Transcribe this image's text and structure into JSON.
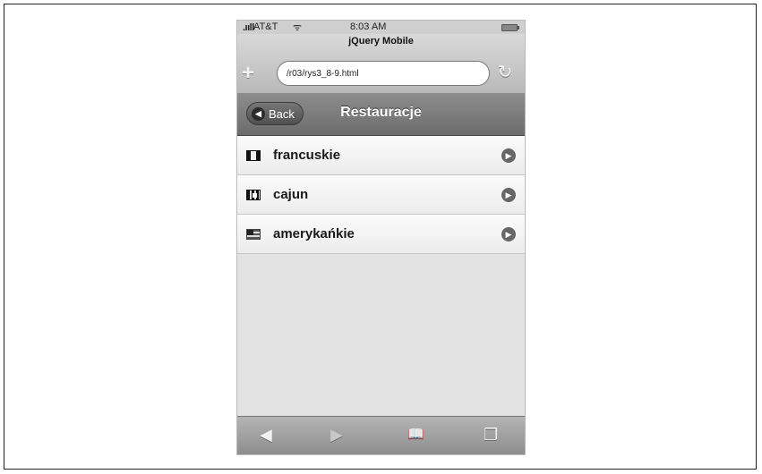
{
  "status": {
    "signal": ".ııll",
    "carrier": "AT&T",
    "wifi": "ᯤ",
    "time": "8:03 AM"
  },
  "safari": {
    "page_title": "jQuery Mobile",
    "url": "/r03/rys3_8-9.html"
  },
  "header": {
    "back_label": "Back",
    "title": "Restauracje"
  },
  "list": [
    {
      "label": "francuskie",
      "icon": "french-flag-icon"
    },
    {
      "label": "cajun",
      "icon": "cajun-flag-icon"
    },
    {
      "label": "amerykańkie",
      "icon": "us-flag-icon"
    }
  ]
}
